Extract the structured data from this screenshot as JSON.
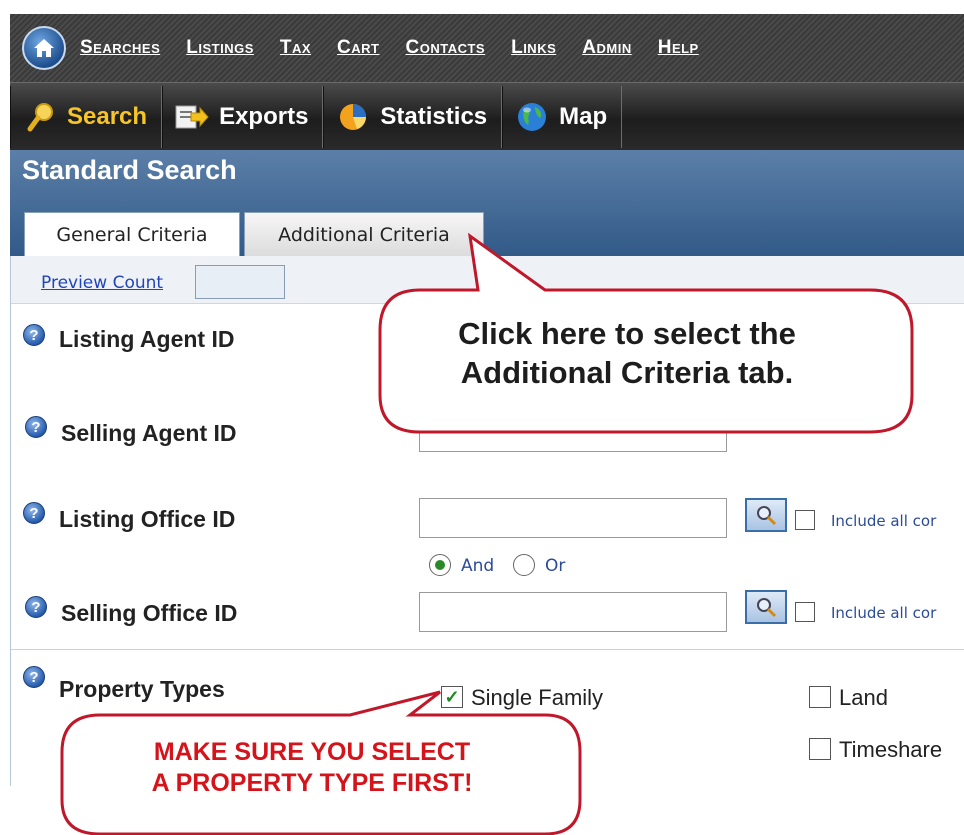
{
  "topnav": {
    "home_icon": "home-icon",
    "items": [
      "Searches",
      "Listings",
      "Tax",
      "Cart",
      "Contacts",
      "Links",
      "Admin",
      "Help"
    ]
  },
  "subnav": {
    "items": [
      {
        "label": "Search",
        "icon": "magnifier-icon",
        "active": true
      },
      {
        "label": "Exports",
        "icon": "export-arrow-icon",
        "active": false
      },
      {
        "label": "Statistics",
        "icon": "pie-chart-icon",
        "active": false
      },
      {
        "label": "Map",
        "icon": "globe-icon",
        "active": false
      }
    ]
  },
  "header": {
    "title": "Standard Search",
    "tabs": [
      {
        "label": "General Criteria",
        "active": true
      },
      {
        "label": "Additional Criteria",
        "active": false
      }
    ]
  },
  "preview": {
    "link": "Preview Count",
    "value": ""
  },
  "fields": {
    "listing_agent": {
      "label": "Listing Agent ID"
    },
    "selling_agent": {
      "label": "Selling Agent ID"
    },
    "listing_office": {
      "label": "Listing Office ID",
      "include_label": "Include all cor"
    },
    "selling_office": {
      "label": "Selling Office ID",
      "include_label": "Include all cor"
    },
    "and_or": {
      "and_label": "And",
      "or_label": "Or",
      "selected": "And"
    }
  },
  "property_types": {
    "label": "Property Types",
    "options": [
      {
        "label": "Single Family",
        "checked": true
      },
      {
        "label": "Land",
        "checked": false
      },
      {
        "label": "Timeshare",
        "checked": false
      }
    ]
  },
  "callouts": {
    "tab_hint_line1": "Click here to select the",
    "tab_hint_line2": "Additional Criteria tab.",
    "type_hint_line1": "MAKE SURE YOU SELECT",
    "type_hint_line2": "A PROPERTY TYPE FIRST!"
  },
  "colors": {
    "nav_bg": "#3a3a3a",
    "header_blue": "#325a88",
    "active_yellow": "#f7c52a",
    "callout_border": "#c0182a",
    "warning_red": "#d4141a"
  }
}
